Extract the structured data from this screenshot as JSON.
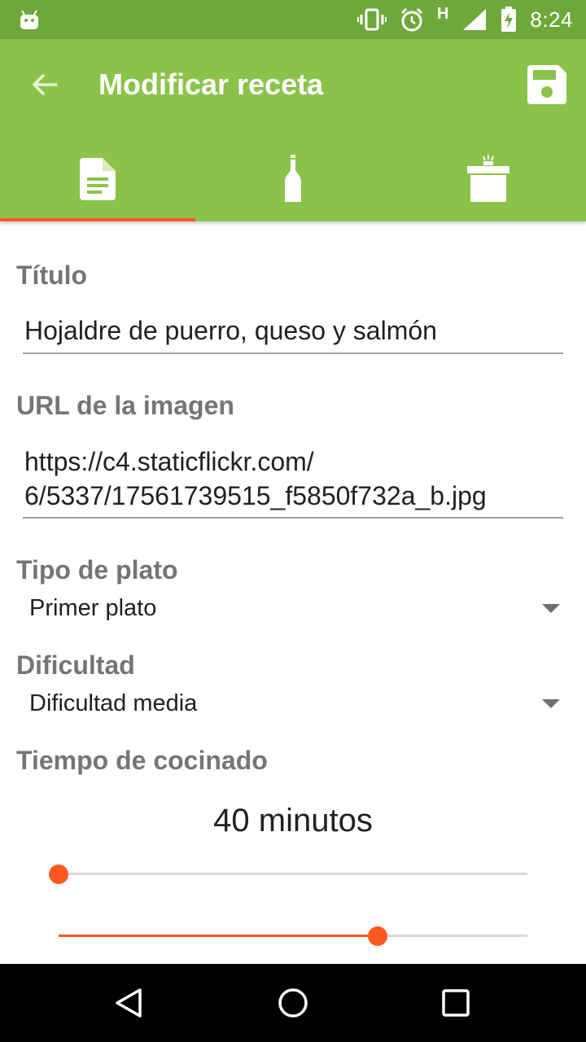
{
  "status_bar": {
    "time": "8:24",
    "network_type": "H",
    "icons": [
      "android-icon",
      "vibrate-icon",
      "alarm-icon",
      "signal-icon",
      "battery-charging-icon"
    ]
  },
  "app_bar": {
    "title": "Modificar receta",
    "back_icon": "arrow-back-icon",
    "save_icon": "save-icon"
  },
  "tabs": [
    {
      "icon": "document-icon",
      "selected": true
    },
    {
      "icon": "bottle-icon",
      "selected": false
    },
    {
      "icon": "pot-icon",
      "selected": false
    }
  ],
  "form": {
    "title_label": "Título",
    "title_value": "Hojaldre de puerro, queso y salmón",
    "image_url_label": "URL de la imagen",
    "image_url_line1": "https://c4.staticflickr.com/",
    "image_url_line2": "6/5337/17561739515_f5850f732a_b.jpg",
    "dish_type_label": "Tipo de plato",
    "dish_type_value": "Primer plato",
    "difficulty_label": "Dificultad",
    "difficulty_value": "Dificultad media",
    "cook_time_label": "Tiempo de cocinado",
    "cook_time_value": "40 minutos",
    "slider_1_fraction": 0.0,
    "slider_2_fraction": 0.68
  },
  "colors": {
    "status_bar": "#6fa83a",
    "primary": "#8bc34a",
    "accent": "#ff5722",
    "label_gray": "#757575"
  }
}
